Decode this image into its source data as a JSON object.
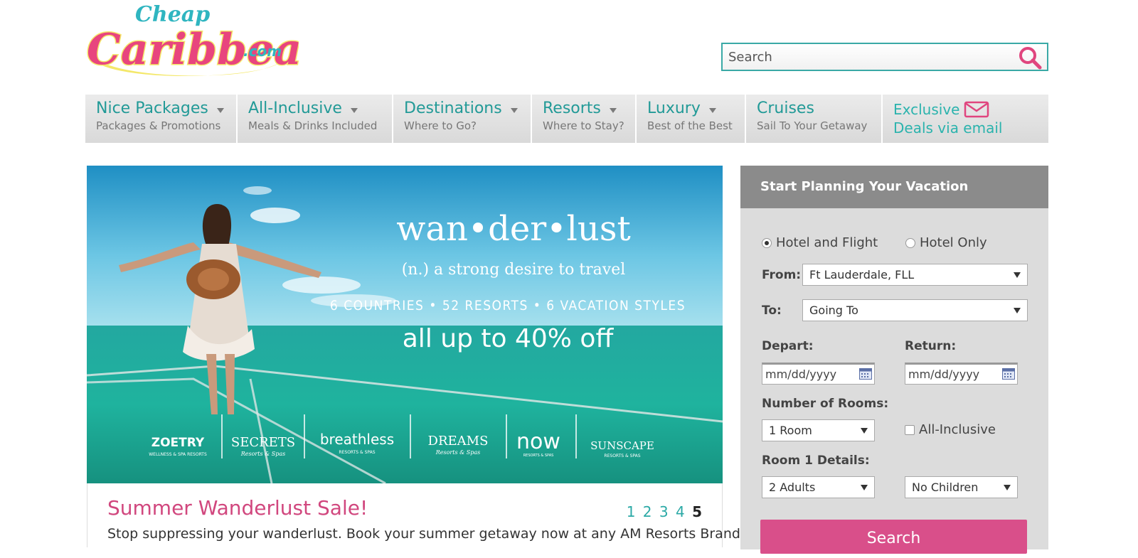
{
  "brand": {
    "logo_top": "Cheap",
    "logo_main": "Caribbean",
    "logo_suffix": ".com"
  },
  "search": {
    "placeholder": "Search",
    "icon": "search-icon"
  },
  "nav": {
    "items": [
      {
        "label": "Nice Packages",
        "sub": "Packages & Promotions"
      },
      {
        "label": "All-Inclusive",
        "sub": "Meals & Drinks Included"
      },
      {
        "label": "Destinations",
        "sub": "Where to Go?"
      },
      {
        "label": "Resorts",
        "sub": "Where to Stay?"
      },
      {
        "label": "Luxury",
        "sub": "Best of the Best"
      },
      {
        "label": "Cruises",
        "sub": "Sail To Your Getaway"
      }
    ],
    "email": {
      "line1": "Exclusive",
      "line2": "Deals via email",
      "icon": "envelope-icon"
    }
  },
  "hero": {
    "headline": "wan•der•lust",
    "definition": "(n.) a strong desire to travel",
    "stats": "6 COUNTRIES • 52 RESORTS • 6 VACATION STYLES",
    "offer": "all up to 40% off",
    "brands": [
      {
        "name": "ZOETRY",
        "sub": "WELLNESS & SPA RESORTS"
      },
      {
        "name": "SECRETS",
        "sub": "Resorts & Spas"
      },
      {
        "name": "breathless",
        "sub": "RESORTS & SPAS"
      },
      {
        "name": "DREAMS",
        "sub": "Resorts & Spas"
      },
      {
        "name": "now",
        "sub": "RESORTS & SPAS"
      },
      {
        "name": "SUNSCAPE",
        "sub": "RESORTS & SPAS"
      }
    ]
  },
  "sale": {
    "title": "Summer Wanderlust Sale!",
    "text": "Stop suppressing your wanderlust. Book your summer getaway now at any AM Resorts Brand and",
    "pages": [
      "1",
      "2",
      "3",
      "4",
      "5"
    ],
    "active_page": "5"
  },
  "planner": {
    "title": "Start Planning Your Vacation",
    "trip_types": [
      {
        "label": "Hotel and Flight",
        "selected": true
      },
      {
        "label": "Hotel Only",
        "selected": false
      }
    ],
    "from_label": "From:",
    "from_value": "Ft Lauderdale, FLL",
    "to_label": "To:",
    "to_value": "Going To",
    "depart_label": "Depart:",
    "return_label": "Return:",
    "date_placeholder": "mm/dd/yyyy",
    "rooms_label": "Number of Rooms:",
    "rooms_value": "1 Room",
    "all_inclusive_label": "All-Inclusive",
    "room_details_label": "Room 1 Details:",
    "adults_value": "2 Adults",
    "children_value": "No Children",
    "submit_label": "Search"
  },
  "colors": {
    "teal": "#229a97",
    "pink": "#d94f8a",
    "panel": "#dcdcdc",
    "panel_head": "#8b8b8b"
  }
}
